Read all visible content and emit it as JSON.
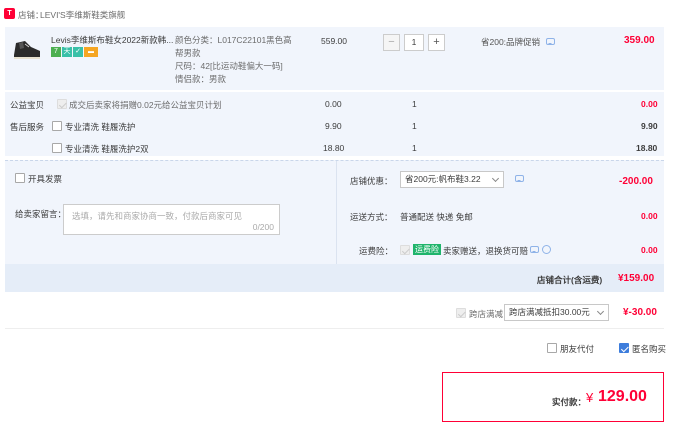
{
  "shop": {
    "label": "店铺：",
    "name": "LEVI'S李维斯鞋类旗舰"
  },
  "item": {
    "title": "Levis李维斯布鞋女2022新款韩...",
    "attrs": [
      "颜色分类：L017C22101黑色高",
      "帮男款",
      "尺码：42[比运动鞋偏大一码]",
      "情侣款：男款"
    ],
    "price": "559.00",
    "qty": "1",
    "promo": "省200:品牌促销",
    "total": "359.00",
    "badges": [
      {
        "text": "7",
        "color": "#4caf50"
      },
      {
        "text": "天",
        "color": "#39c0a8"
      },
      {
        "text": "✓",
        "color": "#39c0a8"
      },
      {
        "text": "▬",
        "color": "#f5a623"
      }
    ]
  },
  "services": [
    {
      "category": "公益宝贝",
      "text": "成交后卖家将捐赠0.02元给公益宝贝计划",
      "price": "0.00",
      "qty": "1",
      "total": "0.00",
      "disabled": true
    },
    {
      "category": "售后服务",
      "text": "专业清洗 鞋履洗护",
      "price": "9.90",
      "qty": "1",
      "total": "9.90",
      "disabled": false
    },
    {
      "category": "",
      "text": "专业清洗 鞋履洗护2双",
      "price": "18.80",
      "qty": "1",
      "total": "18.80",
      "disabled": false
    }
  ],
  "invoice": {
    "label": "开具发票"
  },
  "message": {
    "label": "给卖家留言：",
    "placeholder": "选填，请先和商家协商一致，付款后商家可见",
    "counter": "0/200"
  },
  "shop_discount": {
    "label": "店铺优惠：",
    "value": "省200元:帆布鞋3.22",
    "amount": "-200.00"
  },
  "shipping": {
    "label": "运送方式：",
    "value": "普通配送 快递 免邮",
    "amount": "0.00"
  },
  "insurance": {
    "label": "运费险：",
    "tag": "运费险",
    "text": "卖家赠送，退换货可赔",
    "amount": "0.00"
  },
  "shop_total": {
    "label": "店铺合计(含运费)",
    "value": "¥159.00"
  },
  "cross_store": {
    "label": "跨店满减",
    "value": "跨店满减抵扣30.00元",
    "amount": "¥-30.00"
  },
  "options": {
    "friend_pay": "朋友代付",
    "anonymous": "匿名购买"
  },
  "pay": {
    "label": "实付款：",
    "currency": "¥",
    "amount": "129.00"
  }
}
